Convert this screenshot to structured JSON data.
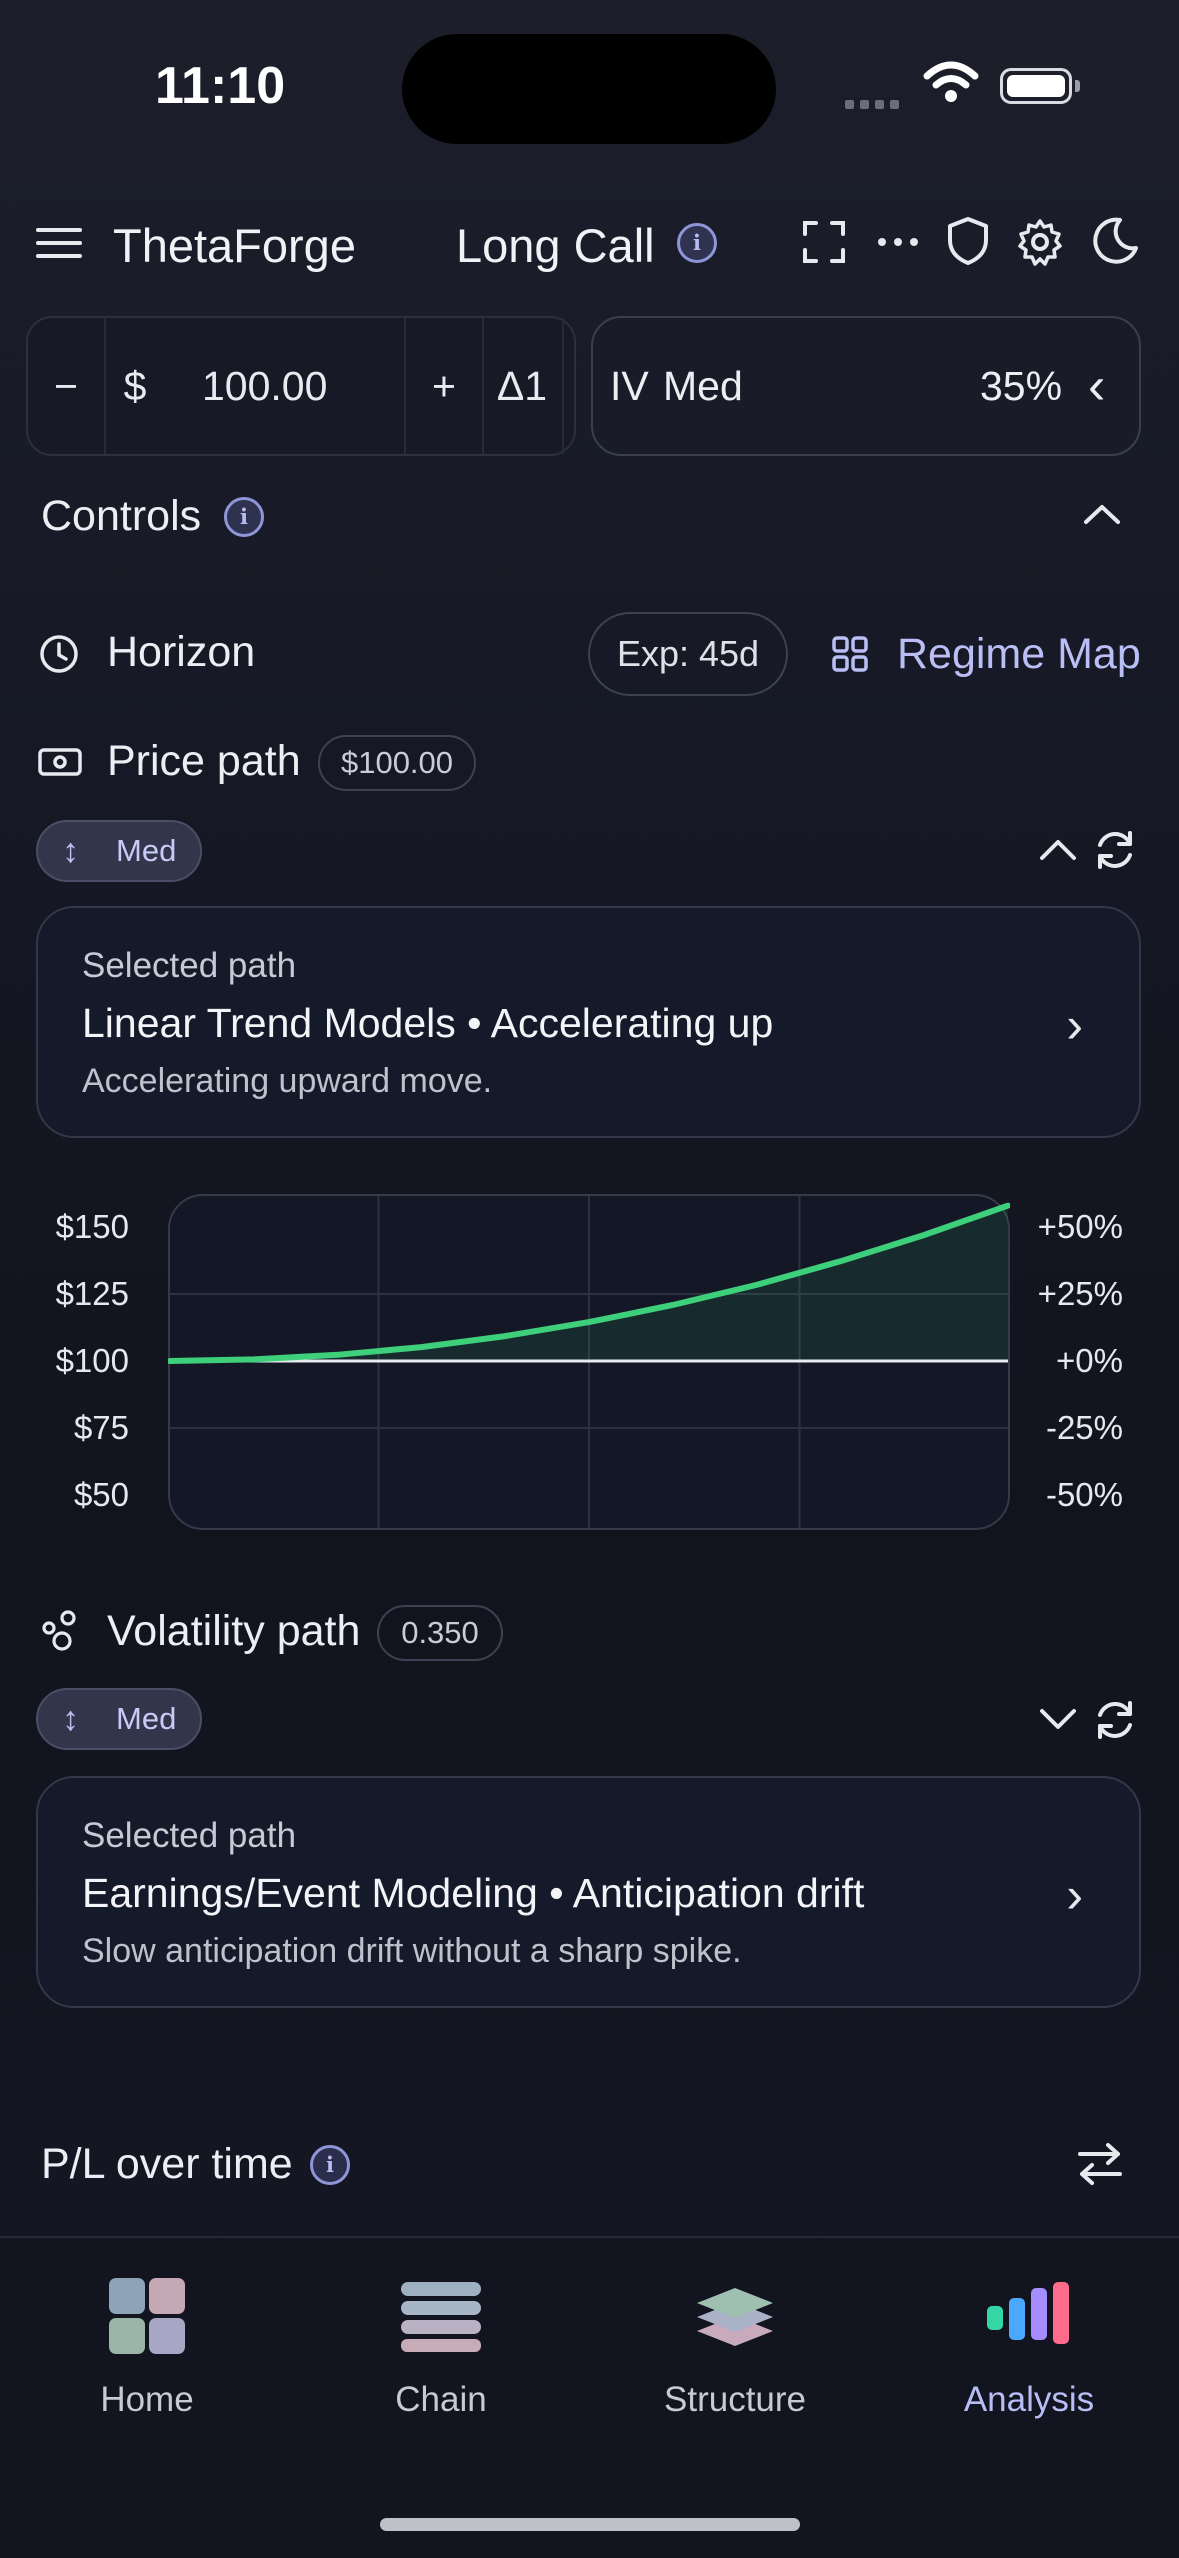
{
  "status": {
    "time": "11:10"
  },
  "header": {
    "app_title": "ThetaForge",
    "strategy": "Long Call",
    "info_icon": "i"
  },
  "stepper": {
    "minus": "−",
    "currency": "$",
    "value": "100.00",
    "plus": "+",
    "delta": "Δ1"
  },
  "iv": {
    "label": "IV",
    "level": "Med",
    "value": "35%",
    "chevron": "‹"
  },
  "controls": {
    "title": "Controls"
  },
  "horizon": {
    "label": "Horizon",
    "exp_button": "Exp: 45d",
    "regime_map": "Regime Map"
  },
  "price_path": {
    "label": "Price path",
    "value_badge": "$100.00",
    "level": "Med",
    "card": {
      "key": "Selected path",
      "title": "Linear Trend Models • Accelerating up",
      "desc": "Accelerating upward move."
    }
  },
  "chart_data": {
    "type": "line",
    "left_ticks": [
      "$150",
      "$125",
      "$100",
      "$75",
      "$50"
    ],
    "right_ticks": [
      "+50%",
      "+25%",
      "+0%",
      "-25%",
      "-50%"
    ],
    "ylim": [
      50,
      150
    ],
    "baseline": 100,
    "series": [
      {
        "values": [
          100,
          100.6,
          102.3,
          105.2,
          109.3,
          114.5,
          120.9,
          128.4,
          137.2,
          147.0,
          158.0
        ]
      }
    ],
    "colors": {
      "line": "#3ecf7a",
      "baseline": "#e8eaf0",
      "grid": "#2c3140"
    }
  },
  "vol_path": {
    "label": "Volatility path",
    "value_badge": "0.350",
    "level": "Med",
    "card": {
      "key": "Selected path",
      "title": "Earnings/Event Modeling • Anticipation drift",
      "desc": "Slow anticipation drift without a sharp spike."
    }
  },
  "pl": {
    "title": "P/L over time"
  },
  "tabs": [
    {
      "label": "Home",
      "icon": "home-grid-icon"
    },
    {
      "label": "Chain",
      "icon": "chain-stack-icon"
    },
    {
      "label": "Structure",
      "icon": "structure-layers-icon"
    },
    {
      "label": "Analysis",
      "icon": "analysis-bars-icon"
    }
  ],
  "colors": {
    "accent": "#b9bff5",
    "active_tab": "#b7bdf5"
  }
}
